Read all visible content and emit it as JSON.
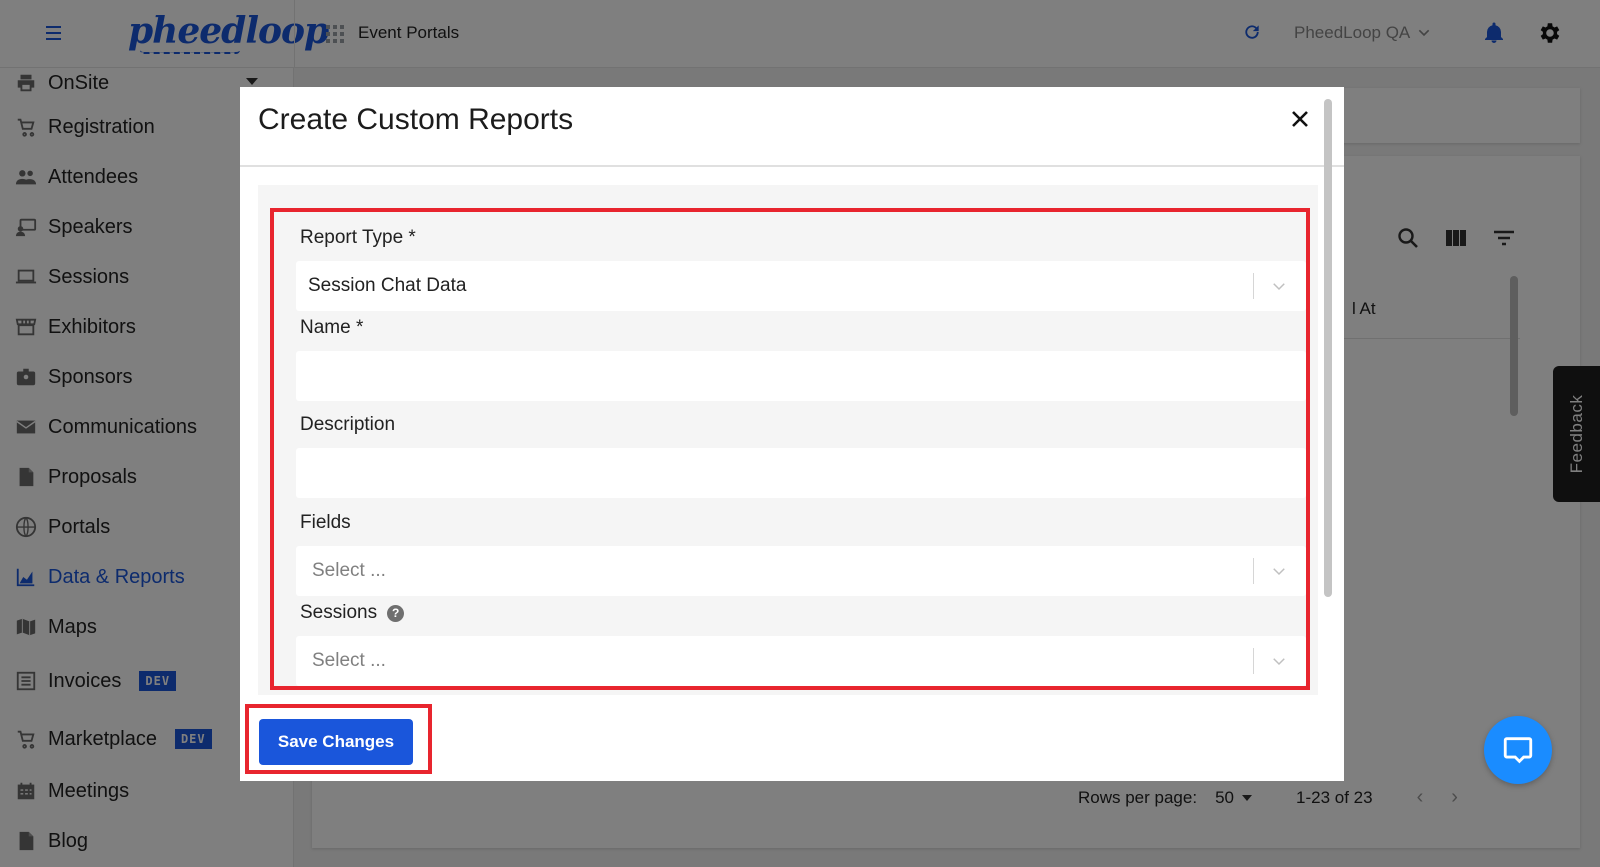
{
  "app": {
    "logo_text": "pheedloop",
    "section_title": "Event Portals",
    "org_selector": "PheedLoop QA"
  },
  "sidebar": {
    "items": [
      {
        "label": "OnSite",
        "icon": "printer-icon",
        "active": false
      },
      {
        "label": "Registration",
        "icon": "cart-icon",
        "active": false
      },
      {
        "label": "Attendees",
        "icon": "people-icon",
        "active": false
      },
      {
        "label": "Speakers",
        "icon": "speaker-icon",
        "active": false
      },
      {
        "label": "Sessions",
        "icon": "laptop-icon",
        "active": false
      },
      {
        "label": "Exhibitors",
        "icon": "storefront-icon",
        "active": false
      },
      {
        "label": "Sponsors",
        "icon": "badge-icon",
        "active": false
      },
      {
        "label": "Communications",
        "icon": "mail-icon",
        "active": false
      },
      {
        "label": "Proposals",
        "icon": "file-icon",
        "active": false
      },
      {
        "label": "Portals",
        "icon": "globe-icon",
        "active": false
      },
      {
        "label": "Data & Reports",
        "icon": "chart-icon",
        "active": true
      },
      {
        "label": "Maps",
        "icon": "map-icon",
        "active": false
      },
      {
        "label": "Invoices",
        "icon": "list-icon",
        "active": false,
        "badge": "DEV"
      },
      {
        "label": "Marketplace",
        "icon": "cart-icon",
        "active": false,
        "badge": "DEV"
      },
      {
        "label": "Meetings",
        "icon": "calendar-icon",
        "active": false
      },
      {
        "label": "Blog",
        "icon": "file-icon",
        "active": false
      }
    ]
  },
  "table": {
    "column_partial": "l At",
    "rows_per_page_label": "Rows per page:",
    "rows_per_page_value": "50",
    "range": "1-23 of 23",
    "prev": "‹",
    "next": "›"
  },
  "feedback_label": "Feedback",
  "modal": {
    "title": "Create Custom Reports",
    "close": "✕",
    "fields": {
      "report_type_label": "Report Type *",
      "report_type_value": "Session Chat Data",
      "name_label": "Name *",
      "name_value": "",
      "description_label": "Description",
      "description_value": "",
      "fields_label": "Fields",
      "fields_placeholder": "Select ...",
      "sessions_label": "Sessions",
      "sessions_help": "?",
      "sessions_placeholder": "Select ..."
    },
    "save_label": "Save Changes"
  },
  "colors": {
    "primary": "#1a56db",
    "highlight": "#e8252e",
    "chat": "#1a8cff"
  }
}
